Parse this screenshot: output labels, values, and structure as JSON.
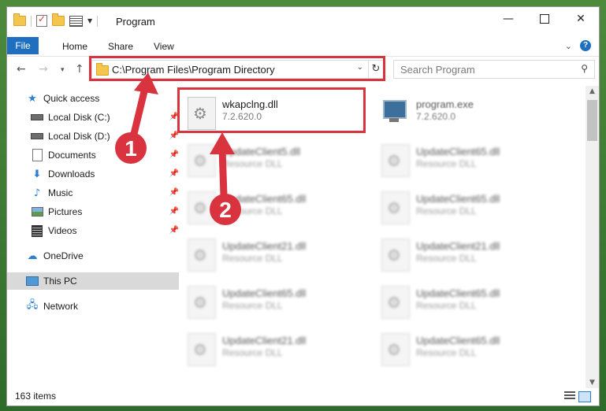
{
  "window": {
    "title": "Program"
  },
  "ribbon": {
    "tabs": [
      "File",
      "Home",
      "Share",
      "View"
    ]
  },
  "address": {
    "path": "C:\\Program Files\\Program Directory"
  },
  "search": {
    "placeholder": "Search Program"
  },
  "sidebar": {
    "items": [
      {
        "label": "Quick access",
        "icon": "star-icon"
      },
      {
        "label": "Local Disk (C:)",
        "icon": "drive-icon",
        "pinned": true
      },
      {
        "label": "Local Disk (D:)",
        "icon": "drive-icon",
        "pinned": true
      },
      {
        "label": "Documents",
        "icon": "documents-icon",
        "pinned": true
      },
      {
        "label": "Downloads",
        "icon": "download-icon",
        "pinned": true
      },
      {
        "label": "Music",
        "icon": "music-icon",
        "pinned": true
      },
      {
        "label": "Pictures",
        "icon": "pictures-icon",
        "pinned": true
      },
      {
        "label": "Videos",
        "icon": "video-icon",
        "pinned": true
      },
      {
        "label": "OneDrive",
        "icon": "cloud-icon"
      },
      {
        "label": "This PC",
        "icon": "computer-icon",
        "selected": true
      },
      {
        "label": "Network",
        "icon": "network-icon"
      }
    ]
  },
  "files": [
    {
      "name": "wkapclng.dll",
      "sub": "7.2.620.0"
    },
    {
      "name": "program.exe",
      "sub": "7.2.620.0"
    },
    {
      "name": "UpdateClient5.dll",
      "sub": "Resource DLL"
    },
    {
      "name": "UpdateClient65.dll",
      "sub": "Resource DLL"
    },
    {
      "name": "UpdateClient65.dll",
      "sub": "Resource DLL"
    },
    {
      "name": "UpdateClient65.dll",
      "sub": "Resource DLL"
    },
    {
      "name": "UpdateClient21.dll",
      "sub": "Resource DLL"
    },
    {
      "name": "UpdateClient21.dll",
      "sub": "Resource DLL"
    },
    {
      "name": "UpdateClient65.dll",
      "sub": "Resource DLL"
    },
    {
      "name": "UpdateClient65.dll",
      "sub": "Resource DLL"
    },
    {
      "name": "UpdateClient21.dll",
      "sub": "Resource DLL"
    },
    {
      "name": "UpdateClient65.dll",
      "sub": "Resource DLL"
    }
  ],
  "status": {
    "items": "163 items"
  },
  "annotations": {
    "step1": "1",
    "step2": "2",
    "color": "#d9333f"
  }
}
